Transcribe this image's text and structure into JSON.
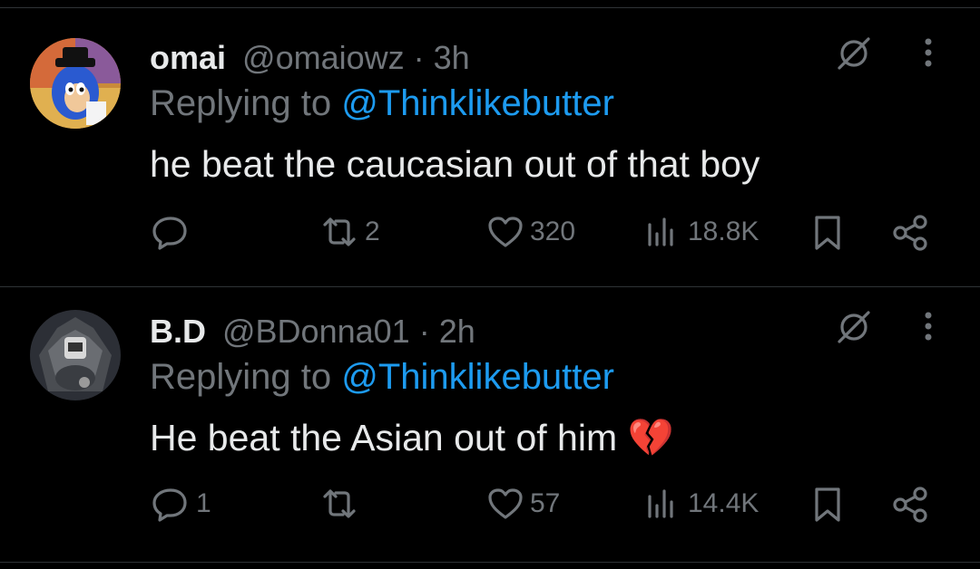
{
  "tweets": [
    {
      "display_name": "omai",
      "handle": "@omaiowz",
      "time": "3h",
      "replying_label": "Replying to",
      "replying_to": "@Thinklikebutter",
      "text": "he beat the caucasian out of that boy",
      "emoji": "",
      "replies": "",
      "retweets": "2",
      "likes": "320",
      "views": "18.8K"
    },
    {
      "display_name": "B.D",
      "handle": "@BDonna01",
      "time": "2h",
      "replying_label": "Replying to",
      "replying_to": "@Thinklikebutter",
      "text": "He beat the Asian out of him",
      "emoji": "💔",
      "replies": "1",
      "retweets": "",
      "likes": "57",
      "views": "14.4K"
    }
  ],
  "icons": {
    "reply": "reply-icon",
    "retweet": "retweet-icon",
    "like": "heart-icon",
    "views": "views-icon",
    "bookmark": "bookmark-icon",
    "share": "share-icon",
    "grok": "grok-icon",
    "more": "more-icon"
  },
  "colors": {
    "background": "#000000",
    "text": "#e7e9ea",
    "muted": "#71767b",
    "link": "#1d9bf0",
    "divider": "#2f3336"
  }
}
